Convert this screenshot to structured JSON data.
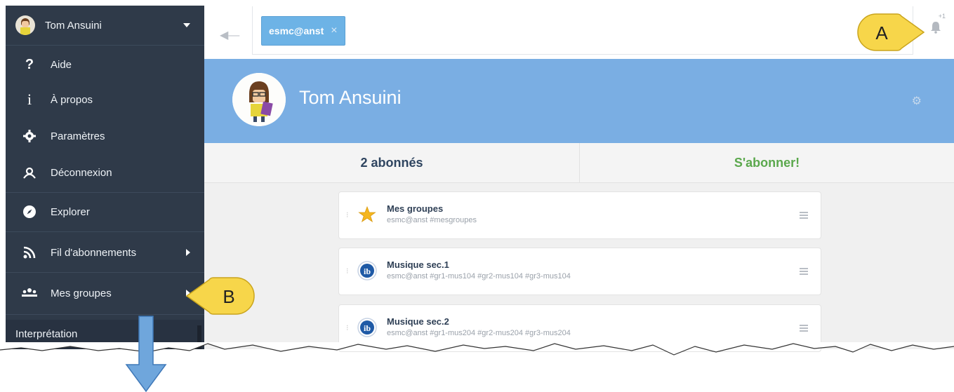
{
  "sidebar": {
    "user_name": "Tom Ansuini",
    "items": [
      {
        "label": "Aide",
        "icon": "question-icon"
      },
      {
        "label": "À propos",
        "icon": "info-icon"
      },
      {
        "label": "Paramètres",
        "icon": "gear-icon"
      },
      {
        "label": "Déconnexion",
        "icon": "logout-icon"
      },
      {
        "label": "Explorer",
        "icon": "compass-icon"
      },
      {
        "label": "Fil d'abonnements",
        "icon": "rss-icon"
      },
      {
        "label": "Mes groupes",
        "icon": "group-icon"
      }
    ],
    "footer_label": "Interprétation"
  },
  "topbar": {
    "chip_label": "esmc@anst",
    "chip_close": "×",
    "notif_count": "+1"
  },
  "profile": {
    "name": "Tom Ansuini",
    "followers": "2 abonnés",
    "subscribe": "S'abonner!"
  },
  "groups": [
    {
      "title": "Mes groupes",
      "subtitle": "esmc@anst #mesgroupes",
      "icon": "star-icon"
    },
    {
      "title": "Musique sec.1",
      "subtitle": "esmc@anst #gr1-mus104 #gr2-mus104 #gr3-mus104",
      "icon": "ib-logo-icon"
    },
    {
      "title": "Musique sec.2",
      "subtitle": "esmc@anst #gr1-mus204 #gr2-mus204 #gr3-mus204",
      "icon": "ib-logo-icon"
    }
  ],
  "callouts": {
    "a": "A",
    "b": "B"
  },
  "colors": {
    "sidebar": "#2f3a49",
    "banner": "#7aaee3",
    "chip": "#6db3e6",
    "subscribe": "#5ba84d",
    "callout": "#f7d64a"
  }
}
